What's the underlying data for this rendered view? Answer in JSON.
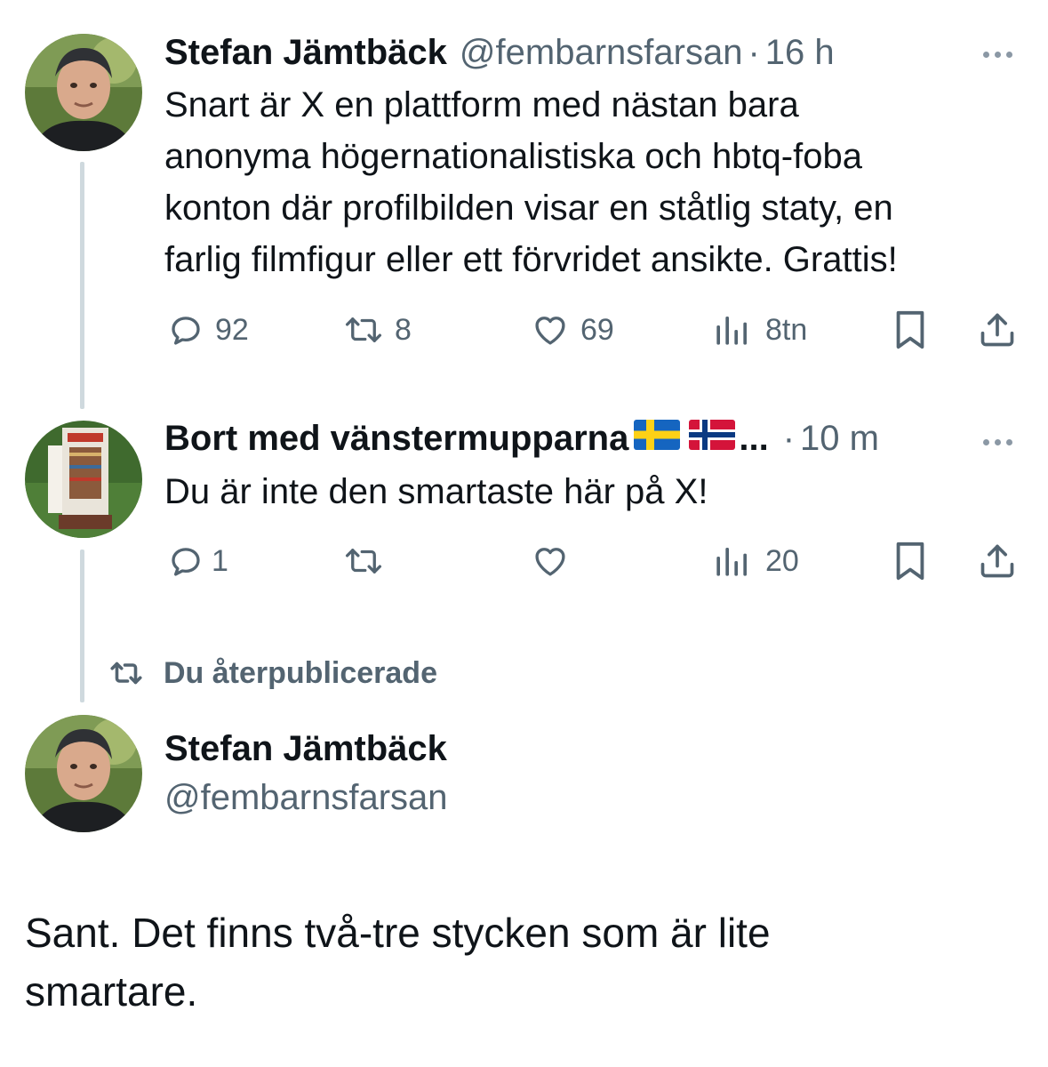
{
  "tweets": [
    {
      "name": "Stefan Jämtbäck",
      "handle": "@fembarnsfarsan",
      "sep": "·",
      "time": "16 h",
      "text_lines": [
        "Snart är X en plattform med nästan bara",
        "anonyma högernationalistiska och hbtq-foba",
        "konton där profilbilden visar en ståtlig staty, en",
        "farlig filmfigur eller ett förvridet ansikte. Grattis!"
      ],
      "replies": "92",
      "reposts": "8",
      "likes": "69",
      "views": "8tn"
    },
    {
      "name": "Bort med vänstermupparna",
      "flags": [
        "swedish-flag",
        "norwegian-flag"
      ],
      "ellipsis": "...",
      "sep": "·",
      "time": "10 m",
      "text": "Du är inte den smartaste här på X!",
      "replies": "1",
      "reposts": "",
      "likes": "",
      "views": "20"
    }
  ],
  "repost_banner": "Du återpublicerade",
  "main_tweet": {
    "name": "Stefan Jämtbäck",
    "handle": "@fembarnsfarsan",
    "text_lines": [
      "Sant. Det finns två-tre stycken som är lite",
      "smartare."
    ]
  },
  "colors": {
    "text": "#0f1419",
    "muted": "#536471",
    "thread_line": "#cfd9de",
    "icon": "#536471"
  }
}
